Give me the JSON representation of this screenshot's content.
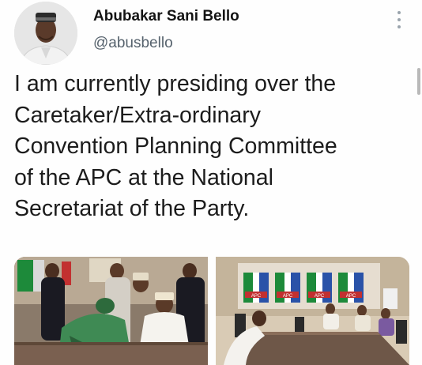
{
  "author": {
    "display_name": "Abubakar Sani Bello",
    "handle": "@abusbello",
    "avatar_icon": "profile-photo"
  },
  "menu": {
    "icon": "more-options-icon"
  },
  "tweet": {
    "lines": [
      "I am currently presiding over the",
      "Caretaker/Extra-ordinary",
      "Convention Planning Committee",
      "of the APC at the National",
      "Secretariat of the Party."
    ]
  },
  "media": {
    "photos": [
      {
        "description": "meeting-photo-left"
      },
      {
        "description": "meeting-photo-right",
        "banner_text": "APC"
      }
    ]
  },
  "colors": {
    "text": "#1c1c1c",
    "secondary_text": "#56626d",
    "icon": "#9aa4ad"
  }
}
